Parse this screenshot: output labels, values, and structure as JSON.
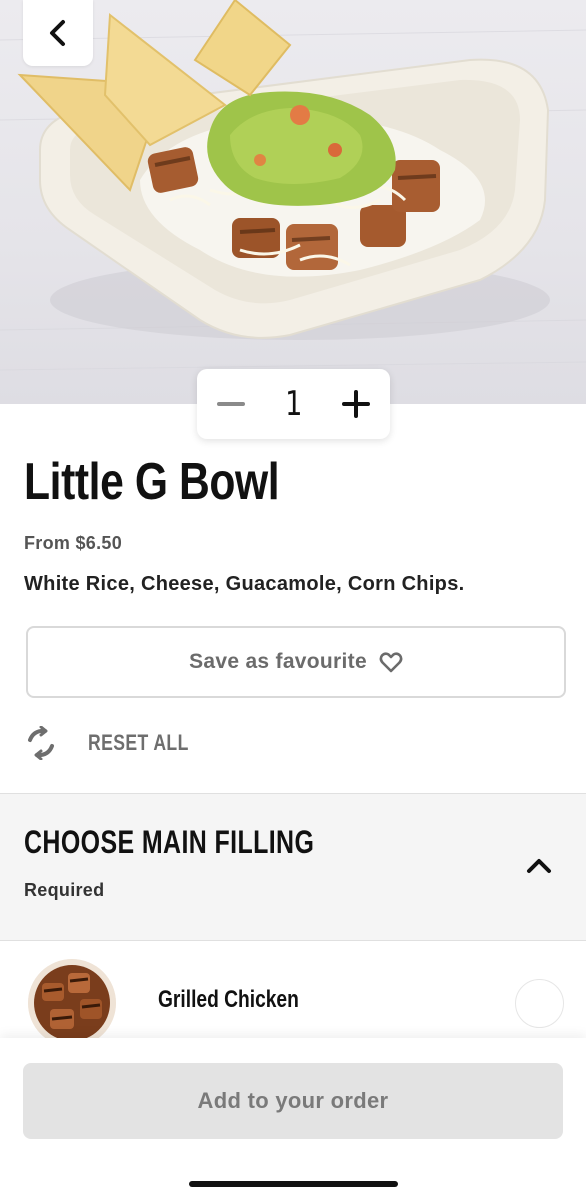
{
  "product": {
    "image_alt": "Bowl with white rice, grilled chicken, cheese, guacamole and corn chips",
    "title": "Little G Bowl",
    "price": "From $6.50",
    "description": "White Rice, Cheese, Guacamole, Corn Chips."
  },
  "quantity": {
    "value": "1",
    "decrement_icon": "minus-icon",
    "increment_icon": "plus-icon"
  },
  "nav": {
    "back_icon": "chevron-left-icon"
  },
  "actions": {
    "save_favourite_label": "Save as favourite",
    "save_favourite_icon": "heart-icon",
    "reset_label": "RESET ALL",
    "reset_icon": "refresh-icon",
    "add_to_order_label": "Add to your order"
  },
  "section": {
    "title": "CHOOSE MAIN FILLING",
    "subtitle": "Required",
    "toggle_icon": "chevron-up-icon",
    "options": [
      {
        "label": "Grilled Chicken",
        "selected": false
      }
    ]
  },
  "colors": {
    "primary_text": "#111111",
    "muted_text": "#6b6b6b",
    "disabled_button": "#e3e3e3",
    "section_bg": "#f5f5f5"
  }
}
